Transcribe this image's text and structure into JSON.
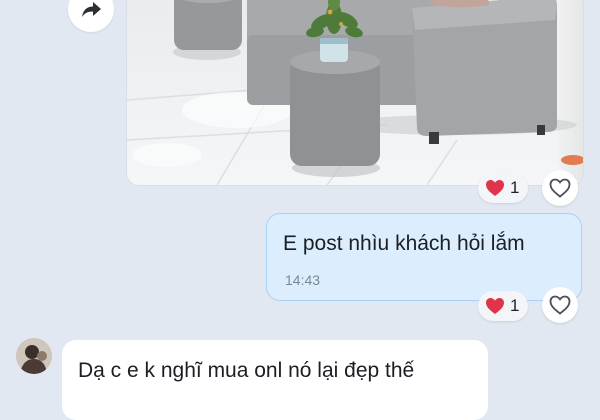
{
  "messages": [
    {
      "id": "photo",
      "direction": "outgoing",
      "type": "image",
      "reaction": {
        "icon": "heart-icon",
        "count": "1"
      }
    },
    {
      "id": "text-out",
      "direction": "outgoing",
      "type": "text",
      "text": "E post nhìu khách hỏi lắm",
      "time": "14:43",
      "reaction": {
        "icon": "heart-icon",
        "count": "1"
      }
    },
    {
      "id": "text-in",
      "direction": "incoming",
      "type": "text",
      "text": "Dạ c e k nghĩ mua onl nó lại đẹp thế"
    }
  ],
  "icons": {
    "share": "share-arrow-icon",
    "like": "heart-outline-icon",
    "reaction": "heart-icon"
  },
  "colors": {
    "background": "#e2e8f1",
    "outgoing_bubble": "#dceefe",
    "outgoing_border": "#a9cff4",
    "incoming_bubble": "#ffffff",
    "reaction_heart": "#e0344a",
    "timestamp": "#7d8894"
  }
}
